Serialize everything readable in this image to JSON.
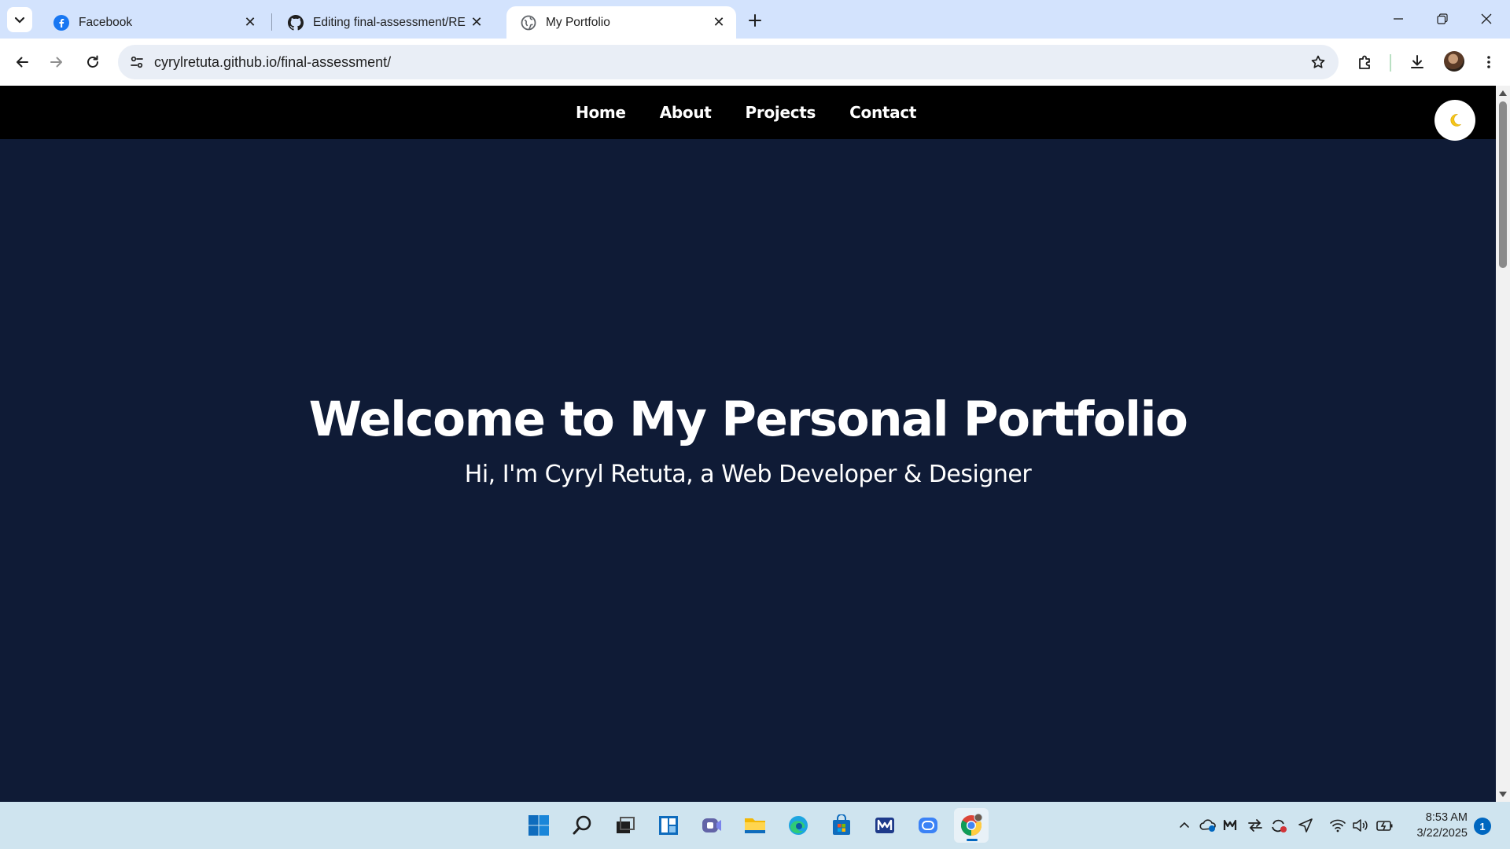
{
  "browser": {
    "tabs": [
      {
        "title": "Facebook",
        "icon": "facebook-icon",
        "active": false
      },
      {
        "title": "Editing final-assessment/README.md",
        "icon": "github-icon",
        "active": false
      },
      {
        "title": "My Portfolio",
        "icon": "globe-icon",
        "active": true
      }
    ],
    "address": "cyrylretuta.github.io/final-assessment/"
  },
  "site": {
    "nav": [
      "Home",
      "About",
      "Projects",
      "Contact"
    ],
    "theme_toggle_icon": "🌙",
    "hero": {
      "title": "Welcome to My Personal Portfolio",
      "subtitle": "Hi, I'm Cyryl Retuta, a Web Developer & Designer"
    },
    "colors": {
      "background": "#0f1b36",
      "nav_background": "#000000",
      "text": "#ffffff"
    }
  },
  "taskbar": {
    "apps": [
      "start-icon",
      "search-icon",
      "task-view-icon",
      "widgets-icon",
      "teams-icon",
      "file-explorer-icon",
      "edge-icon",
      "store-icon",
      "mail-icon",
      "chat-icon",
      "chrome-icon"
    ],
    "clock": {
      "time": "8:53 AM",
      "date": "3/22/2025"
    },
    "notifications": "1"
  }
}
